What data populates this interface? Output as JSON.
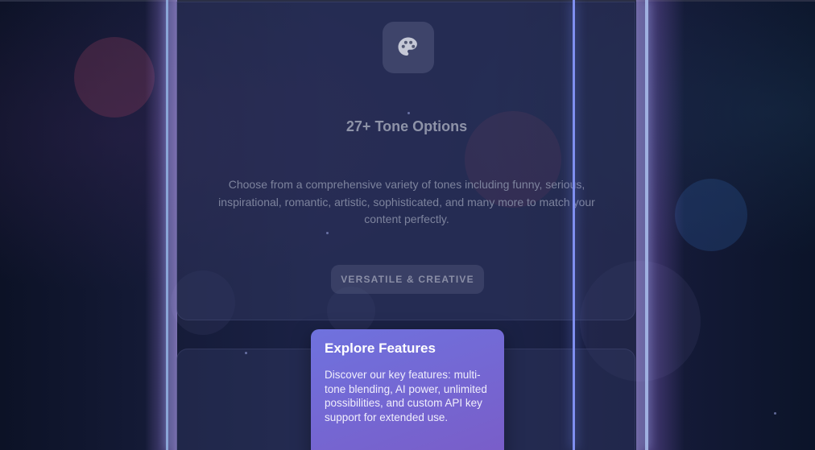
{
  "feature_card": {
    "icon": "palette-icon",
    "title": "27+ Tone Options",
    "description": "Choose from a comprehensive variety of tones including funny, serious, inspirational, romantic, artistic, sophisticated, and many more to match your content perfectly.",
    "badge": "VERSATILE & CREATIVE"
  },
  "tooltip": {
    "title": "Explore Features",
    "body": "Discover our key features: multi-tone blending, AI power, unlimited possibilities, and custom API key support for extended use."
  },
  "colors": {
    "background": "#0d1428",
    "tooltip_start": "#6f72de",
    "tooltip_end": "#7a5cc7",
    "highlight_line": "#7f8ff0"
  }
}
